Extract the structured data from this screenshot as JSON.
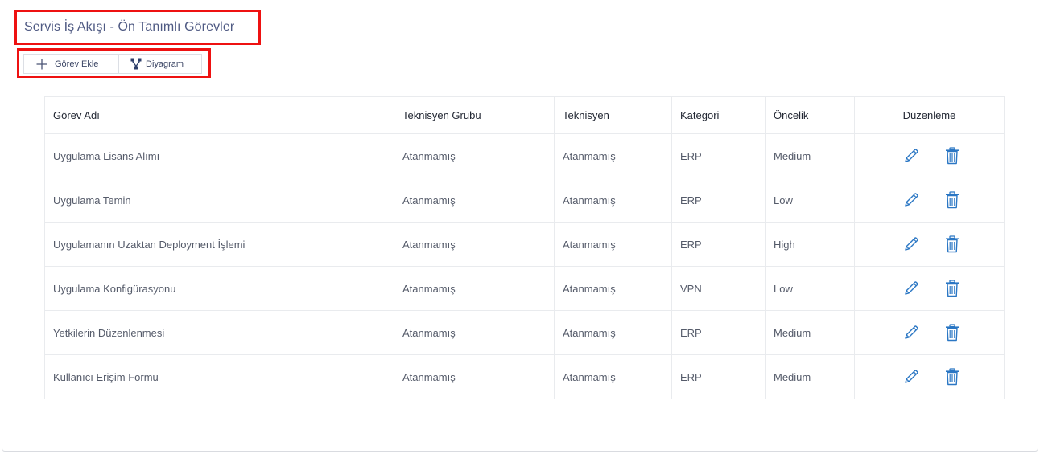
{
  "page": {
    "title": "Servis İş Akışı - Ön Tanımlı Görevler"
  },
  "toolbar": {
    "add_task_label": "Görev Ekle",
    "add_task_icon": "plus-icon",
    "diagram_label": "Diyagram",
    "diagram_icon": "flow-diagram-icon"
  },
  "table": {
    "columns": {
      "task_name": "Görev Adı",
      "technician_group": "Teknisyen Grubu",
      "technician": "Teknisyen",
      "category": "Kategori",
      "priority": "Öncelik",
      "edit": "Düzenleme"
    },
    "rows": [
      {
        "task_name": "Uygulama Lisans Alımı",
        "technician_group": "Atanmamış",
        "technician": "Atanmamış",
        "category": "ERP",
        "priority": "Medium"
      },
      {
        "task_name": "Uygulama Temin",
        "technician_group": "Atanmamış",
        "technician": "Atanmamış",
        "category": "ERP",
        "priority": "Low"
      },
      {
        "task_name": "Uygulamanın Uzaktan Deployment İşlemi",
        "technician_group": "Atanmamış",
        "technician": "Atanmamış",
        "category": "ERP",
        "priority": "High"
      },
      {
        "task_name": "Uygulama Konfigürasyonu",
        "technician_group": "Atanmamış",
        "technician": "Atanmamış",
        "category": "VPN",
        "priority": "Low"
      },
      {
        "task_name": "Yetkilerin Düzenlenmesi",
        "technician_group": "Atanmamış",
        "technician": "Atanmamış",
        "category": "ERP",
        "priority": "Medium"
      },
      {
        "task_name": "Kullanıcı Erişim Formu",
        "technician_group": "Atanmamış",
        "technician": "Atanmamış",
        "category": "ERP",
        "priority": "Medium"
      }
    ],
    "row_actions": {
      "edit_icon": "pencil-icon",
      "delete_icon": "trash-icon"
    }
  },
  "colors": {
    "title_text": "#4f5a83",
    "highlight_border": "#ee1111",
    "icon_blue": "#2b77c4",
    "grid_line": "#e9ebee"
  }
}
